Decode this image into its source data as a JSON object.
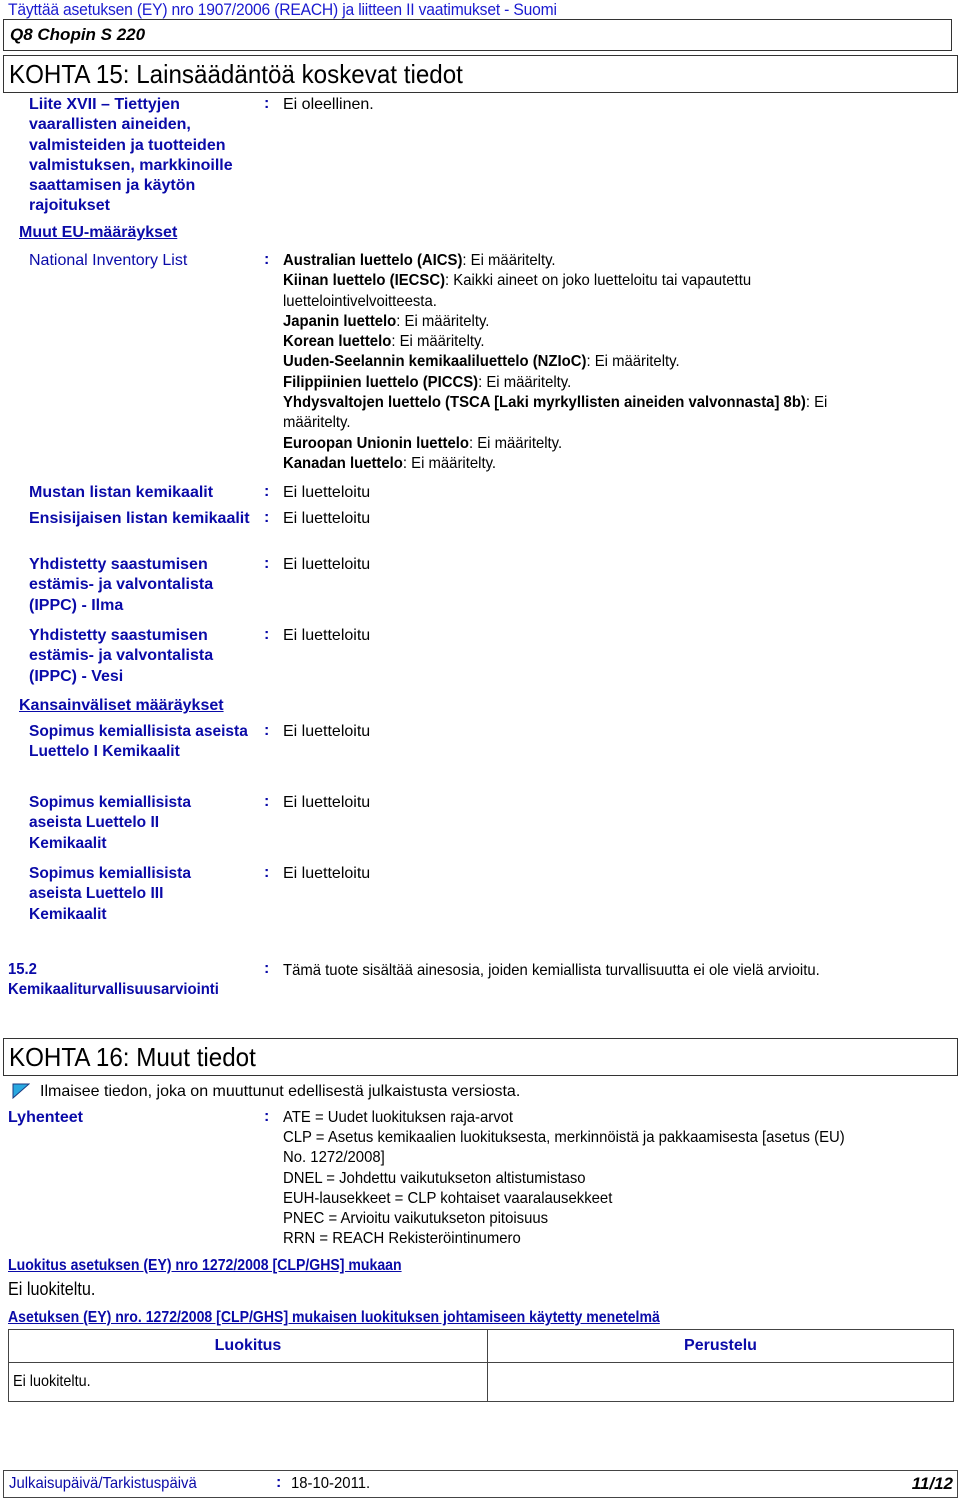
{
  "header": {
    "title": "Täyttää asetuksen (EY) nro 1907/2006 (REACH) ja liitteen II vaatimukset - Suomi",
    "product_name": "Q8 Chopin S 220"
  },
  "section15": {
    "title": "KOHTA 15: Lainsäädäntöä koskevat tiedot",
    "annex_xvii": {
      "label": "Liite XVII – Tiettyjen vaarallisten aineiden, valmisteiden ja tuotteiden valmistuksen, markkinoille saattamisen ja käytön rajoitukset",
      "value": "Ei oleellinen."
    },
    "other_eu_heading": "Muut EU-määräykset",
    "national_inventory": {
      "label": "National Inventory List",
      "entries": [
        {
          "name": "Australian luettelo (AICS)",
          "value": ": Ei määritelty."
        },
        {
          "name": "Kiinan luettelo (IECSC)",
          "value": ": Kaikki aineet on joko luetteloitu tai vapautettu"
        },
        {
          "name": "",
          "value": "luettelointivelvoitteesta."
        },
        {
          "name": "Japanin luettelo",
          "value": ": Ei määritelty."
        },
        {
          "name": "Korean luettelo",
          "value": ": Ei määritelty."
        },
        {
          "name": "Uuden-Seelannin kemikaaliluettelo (NZIoC)",
          "value": ": Ei määritelty."
        },
        {
          "name": "Filippiinien luettelo (PICCS)",
          "value": ": Ei määritelty."
        },
        {
          "name": "Yhdysvaltojen luettelo (TSCA [Laki myrkyllisten aineiden valvonnasta] 8b)",
          "value": ": Ei"
        },
        {
          "name": "",
          "value": "määritelty."
        },
        {
          "name": "Euroopan Unionin luettelo",
          "value": ": Ei määritelty."
        },
        {
          "name": "Kanadan luettelo",
          "value": ": Ei määritelty."
        }
      ]
    },
    "lists": [
      {
        "label": "Mustan listan kemikaalit",
        "value": "Ei luetteloitu"
      },
      {
        "label": "Ensisijaisen listan kemikaalit",
        "value": "Ei luetteloitu"
      },
      {
        "label": "Yhdistetty saastumisen estämis- ja valvontalista (IPPC) - Ilma",
        "value": "Ei luetteloitu"
      },
      {
        "label": "Yhdistetty saastumisen estämis- ja valvontalista (IPPC) - Vesi",
        "value": "Ei luetteloitu"
      }
    ],
    "international_heading": "Kansainväliset määräykset",
    "chemical_weapons": [
      {
        "label": "Sopimus kemiallisista aseista Luettelo I Kemikaalit",
        "value": "Ei luetteloitu"
      },
      {
        "label": "Sopimus kemiallisista aseista Luettelo II Kemikaalit",
        "value": "Ei luetteloitu"
      },
      {
        "label": "Sopimus kemiallisista aseista Luettelo III Kemikaalit",
        "value": "Ei luetteloitu"
      }
    ],
    "safety_assessment": {
      "label": "15.2 Kemikaaliturvallisuusarviointi",
      "value": "Tämä tuote sisältää ainesosia, joiden kemiallista turvallisuutta ei ole vielä arvioitu."
    }
  },
  "section16": {
    "title": "KOHTA 16: Muut tiedot",
    "change_indicator_icon": "blue-triangle-flag",
    "change_note": "Ilmaisee tiedon, joka on muuttunut edellisestä julkaistusta versiosta.",
    "abbreviations_label": "Lyhenteet",
    "abbreviations": [
      "ATE = Uudet luokituksen raja-arvot",
      "CLP = Asetus kemikaalien luokituksesta, merkinnöistä ja pakkaamisesta [asetus (EU)",
      "No. 1272/2008]",
      "DNEL = Johdettu vaikutukseton altistumistaso",
      "EUH-lausekkeet = CLP kohtaiset vaaralausekkeet",
      "PNEC = Arvioitu vaikutukseton pitoisuus",
      "RRN = REACH Rekisteröintinumero"
    ],
    "clp_heading": "Luokitus asetuksen (EY) nro 1272/2008 [CLP/GHS] mukaan",
    "clp_value": "Ei luokiteltu.",
    "method_heading": "Asetuksen (EY) nro. 1272/2008 [CLP/GHS] mukaisen luokituksen johtamiseen käytetty menetelmä",
    "table": {
      "headers": [
        "Luokitus",
        "Perustelu"
      ],
      "rows": [
        [
          "Ei luokiteltu.",
          ""
        ]
      ]
    }
  },
  "footer": {
    "date_label": "Julkaisupäivä/Tarkistuspäivä",
    "date_value": "18-10-2011.",
    "page": "11/12"
  },
  "colors": {
    "label_blue": "#0a0aa8",
    "title_blue": "#1a1ad0",
    "icon_cyan": "#29a8e0"
  }
}
